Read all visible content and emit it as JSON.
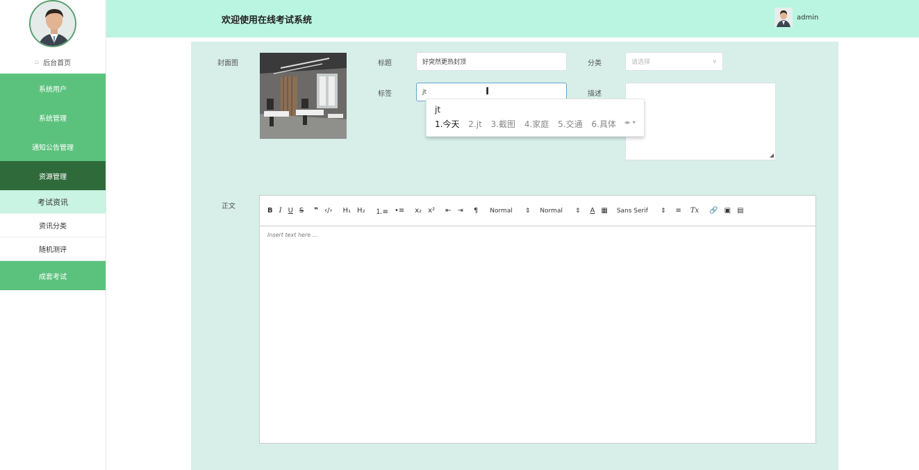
{
  "header": {
    "title": "欢迎使用在线考试系统",
    "username": "admin"
  },
  "sidebar": {
    "home": "后台首页",
    "menu": [
      {
        "label": "系统用户"
      },
      {
        "label": "系统管理"
      },
      {
        "label": "通知公告管理"
      },
      {
        "label": "资源管理"
      }
    ],
    "submenu": [
      {
        "label": "考试资讯"
      },
      {
        "label": "资讯分类"
      },
      {
        "label": "随机测评"
      }
    ],
    "last": "成套考试"
  },
  "form": {
    "cover_label": "封面图",
    "title_label": "标题",
    "title_value": "好突然更热封顶",
    "category_label": "分类",
    "category_placeholder": "请选择",
    "tags_label": "标签",
    "tags_value": "jt",
    "desc_label": "描述",
    "body_label": "正文"
  },
  "ime": {
    "composition": "jt",
    "candidates": [
      "1.今天",
      "2.jt",
      "3.截图",
      "4.家庭",
      "5.交通",
      "6.具体"
    ]
  },
  "editor": {
    "toolbar": {
      "bold": "B",
      "italic": "I",
      "underline": "U",
      "strike": "S",
      "quote": "❞",
      "code": "‹/›",
      "h1": "H₁",
      "h2": "H₂",
      "ol": "⒈≡",
      "ul": "•≡",
      "sub": "x₂",
      "sup": "x²",
      "outdent": "⇤",
      "indent": "⇥",
      "rtl": "¶",
      "size_value": "Normal",
      "header_value": "Normal",
      "color": "A",
      "background": "▦",
      "font_value": "Sans Serif",
      "align": "≡",
      "clean": "Tx",
      "link": "🔗",
      "image": "▣",
      "video": "▤"
    },
    "placeholder": "Insert text here ..."
  },
  "colors": {
    "header_bg": "#baf5e1",
    "menu_bg": "#5bc27d",
    "menu_active_bg": "#2f6b3a",
    "submenu_current_bg": "#c9f3e2",
    "panel_bg": "#d8efe9"
  }
}
